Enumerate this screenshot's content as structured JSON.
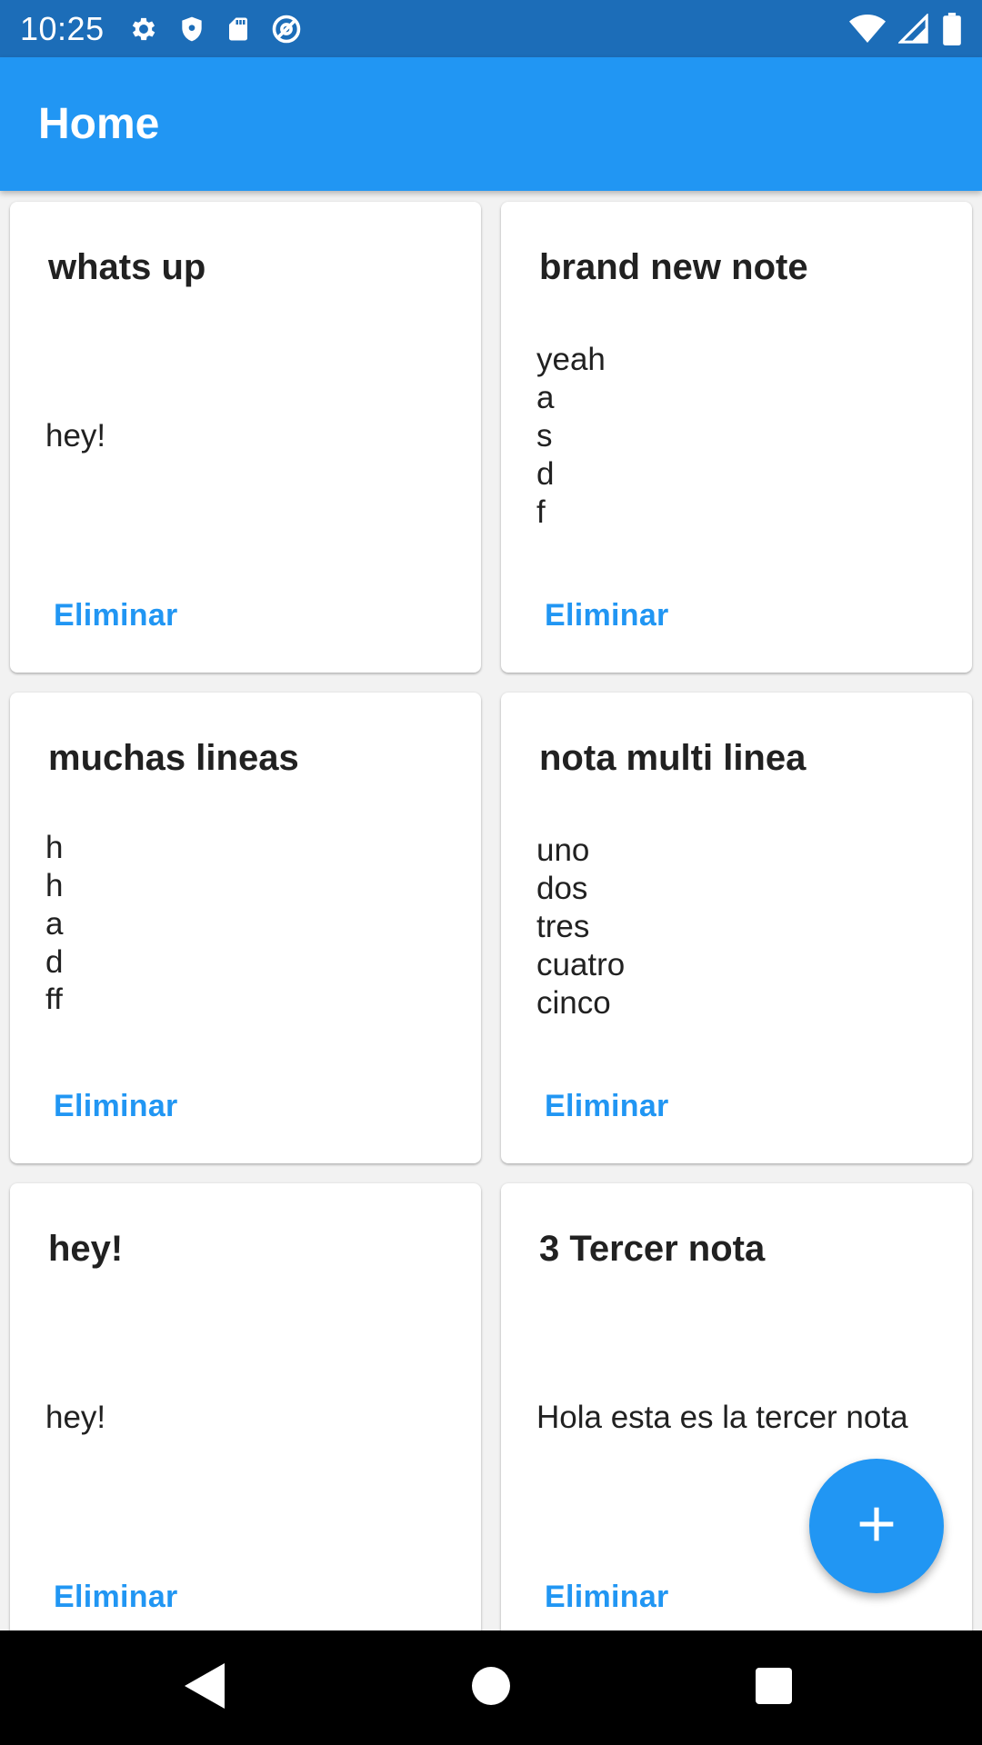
{
  "status_bar": {
    "time": "10:25",
    "left_icons": [
      "gear-icon",
      "shield-icon",
      "sd-card-icon",
      "at-sign-icon"
    ],
    "right_icons": [
      "wifi-icon",
      "cell-signal-icon",
      "battery-icon"
    ]
  },
  "app_bar": {
    "title": "Home"
  },
  "notes": [
    {
      "title": "whats up",
      "body_lines": [
        "hey!"
      ],
      "delete_label": "Eliminar"
    },
    {
      "title": "brand new note",
      "body_lines": [
        "yeah",
        "a",
        "s",
        "d",
        "f"
      ],
      "delete_label": "Eliminar"
    },
    {
      "title": "muchas lineas",
      "body_lines": [
        "h",
        "h",
        "a",
        "d",
        "ff"
      ],
      "delete_label": "Eliminar"
    },
    {
      "title": "nota multi linea",
      "body_lines": [
        "uno",
        "dos",
        "tres",
        "cuatro",
        "cinco"
      ],
      "delete_label": "Eliminar"
    },
    {
      "title": "hey!",
      "body_lines": [
        "hey!"
      ],
      "delete_label": "Eliminar"
    },
    {
      "title": "3 Tercer nota",
      "body_lines": [
        "Hola esta es la tercer nota"
      ],
      "delete_label": "Eliminar"
    }
  ],
  "fab": {
    "icon": "plus-icon"
  },
  "nav_bar": {
    "buttons": [
      "back-icon",
      "home-icon",
      "recents-icon"
    ]
  },
  "colors": {
    "primary": "#2196f3",
    "status_bar": "#1c6db8",
    "text": "#212121"
  }
}
